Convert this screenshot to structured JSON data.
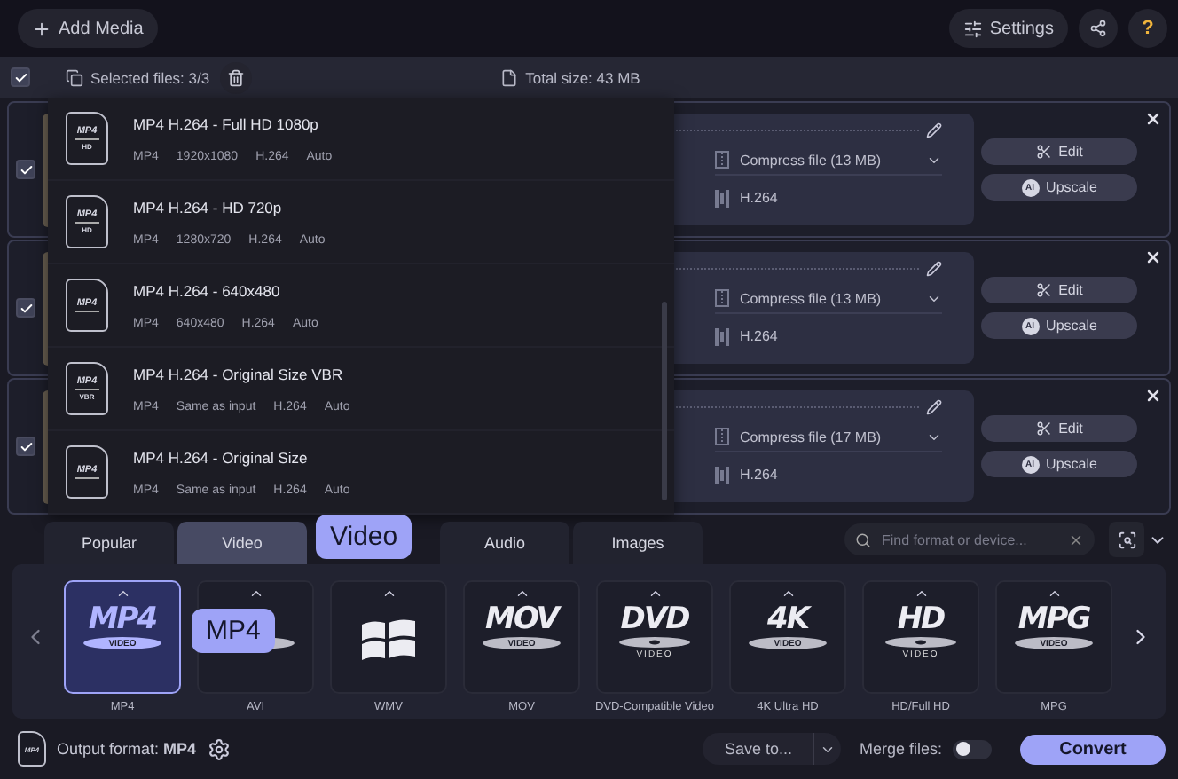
{
  "toolbar": {
    "add_media": "Add Media",
    "settings": "Settings",
    "help": "?"
  },
  "selection_bar": {
    "all_checked": true,
    "selected_files": "Selected files: 3/3",
    "total_size": "Total size: 43 MB"
  },
  "files": [
    {
      "checked": true,
      "compress": "Compress file (13 MB)",
      "codec": "H.264",
      "edit": "Edit",
      "upscale": "Upscale",
      "upscale_badge": "AI"
    },
    {
      "checked": true,
      "compress": "Compress file (13 MB)",
      "codec": "H.264",
      "edit": "Edit",
      "upscale": "Upscale",
      "upscale_badge": "AI"
    },
    {
      "checked": true,
      "compress": "Compress file (17 MB)",
      "codec": "H.264",
      "edit": "Edit",
      "upscale": "Upscale",
      "upscale_badge": "AI"
    }
  ],
  "preset_menu": [
    {
      "title": "MP4 H.264 - Full HD 1080p",
      "icon_text": "MP4",
      "badge": "HD",
      "specs": [
        "MP4",
        "1920x1080",
        "H.264",
        "Auto"
      ]
    },
    {
      "title": "MP4 H.264 - HD 720p",
      "icon_text": "MP4",
      "badge": "HD",
      "specs": [
        "MP4",
        "1280x720",
        "H.264",
        "Auto"
      ]
    },
    {
      "title": "MP4 H.264 - 640x480",
      "icon_text": "MP4",
      "specs": [
        "MP4",
        "640x480",
        "H.264",
        "Auto"
      ]
    },
    {
      "title": "MP4 H.264 - Original Size VBR",
      "icon_text": "MP4",
      "badge": "VBR",
      "specs": [
        "MP4",
        "Same as input",
        "H.264",
        "Auto"
      ]
    },
    {
      "title": "MP4 H.264 - Original Size",
      "icon_text": "MP4",
      "specs": [
        "MP4",
        "Same as input",
        "H.264",
        "Auto"
      ]
    }
  ],
  "format_tabs": [
    {
      "label": "Popular",
      "selected": false
    },
    {
      "label": "Video",
      "selected": true
    },
    {
      "label": "Audio",
      "selected": false
    },
    {
      "label": "Images",
      "selected": false
    }
  ],
  "tab_tooltip": "Video",
  "search": {
    "placeholder": "Find format or device..."
  },
  "formats": [
    {
      "kind": "pill",
      "logo": "MP4",
      "logo_sub": "VIDEO",
      "label": "MP4",
      "selected": true
    },
    {
      "kind": "covered",
      "label": "AVI",
      "selected": false
    },
    {
      "kind": "windows",
      "label": "WMV",
      "selected": false
    },
    {
      "kind": "pill",
      "logo": "MOV",
      "logo_sub": "VIDEO",
      "label": "MOV",
      "selected": false
    },
    {
      "kind": "disc",
      "logo": "DVD",
      "logo_sub": "VIDEO",
      "label": "DVD-Compatible Video",
      "selected": false
    },
    {
      "kind": "pill",
      "logo": "4K",
      "logo_sub": "VIDEO",
      "label": "4K Ultra HD",
      "selected": false
    },
    {
      "kind": "disc",
      "logo": "HD",
      "logo_sub": "VIDEO",
      "label": "HD/Full HD",
      "selected": false
    },
    {
      "kind": "pill",
      "logo": "MPG",
      "logo_sub": "VIDEO",
      "label": "MPG",
      "selected": false
    }
  ],
  "format_tooltip": "MP4",
  "output": {
    "icon_text": "MP4",
    "label": "Output format: **MP4**"
  },
  "save_to": "Save to...",
  "merge": {
    "label": "Merge files:",
    "on": false
  },
  "convert": "Convert"
}
